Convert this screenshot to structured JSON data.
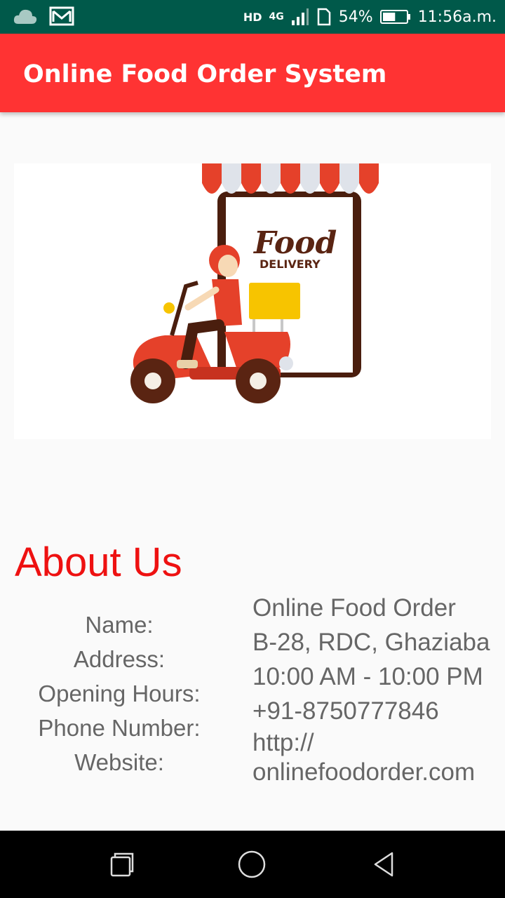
{
  "status_bar": {
    "battery_percent": "54%",
    "time": "11:56a.m.",
    "network": "4G",
    "hd": "HD",
    "battery_level": 0.54,
    "bg_color": "#00594a"
  },
  "app_bar": {
    "title": "Online Food Order System",
    "color": "#ff3333"
  },
  "banner": {
    "food_text": "Food",
    "delivery_text": "DELIVERY"
  },
  "about": {
    "title": "About Us",
    "labels": {
      "name": "Name:",
      "address": "Address:",
      "opening_hours": "Opening Hours:",
      "phone": "Phone Number:",
      "website": "Website:"
    },
    "values": {
      "name": "Online Food Order",
      "address": "B-28, RDC, Ghaziabad",
      "opening_hours": "10:00 AM - 10:00 PM",
      "phone": "+91-8750777846",
      "website": "http:// onlinefoodorder.com"
    }
  },
  "nav": {
    "icons": [
      "recent-apps-icon",
      "home-icon",
      "back-icon"
    ]
  }
}
